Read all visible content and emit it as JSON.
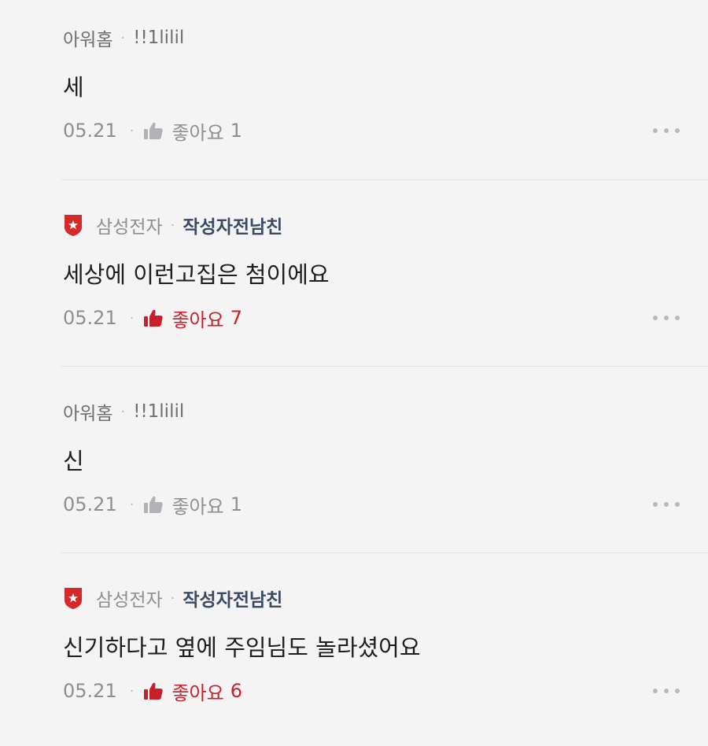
{
  "comments": [
    {
      "company": "",
      "nickname": "아워홈",
      "meta_sep": "·",
      "handle": "!!1lilil",
      "body": "세",
      "date": "05.21",
      "like_label": "좋아요",
      "like_count": "1",
      "liked": false
    },
    {
      "company": "삼성전자",
      "meta_sep": "·",
      "nickname": "작성자전남친",
      "body": "세상에 이런고집은 첨이에요",
      "date": "05.21",
      "like_label": "좋아요",
      "like_count": "7",
      "liked": true
    },
    {
      "company": "",
      "nickname": "아워홈",
      "meta_sep": "·",
      "handle": "!!1lilil",
      "body": "신",
      "date": "05.21",
      "like_label": "좋아요",
      "like_count": "1",
      "liked": false
    },
    {
      "company": "삼성전자",
      "meta_sep": "·",
      "nickname": "작성자전남친",
      "body": "신기하다고 옆에 주임님도 놀라셨어요",
      "date": "05.21",
      "like_label": "좋아요",
      "like_count": "6",
      "liked": true
    }
  ],
  "footer_sep": "·",
  "colors": {
    "background": "#f4f4f5",
    "like_active": "#c8202a",
    "badge_red": "#d42a2a",
    "writer_nickname": "#3c4a66"
  },
  "icons": {
    "badge": "company-shield-icon",
    "like": "thumbs-up-icon",
    "more": "more-options-icon"
  }
}
